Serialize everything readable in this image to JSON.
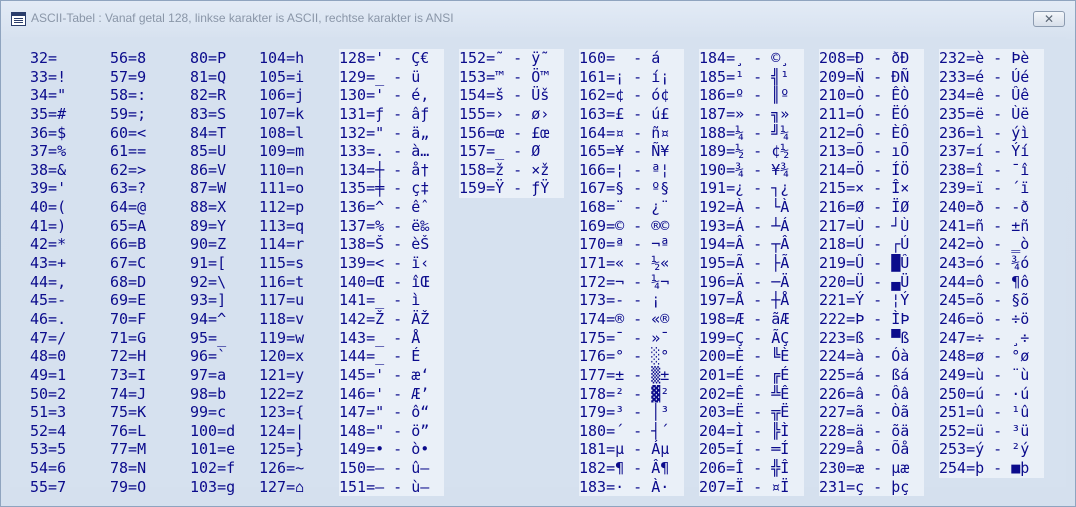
{
  "window": {
    "title": "ASCII-Tabel : Vanaf getal 128, linkse karakter is ASCII, rechtse karakter is ANSI",
    "close_label": "✕"
  },
  "columns": [
    [
      "32= ",
      "33=!",
      "34=\"",
      "35=#",
      "36=$",
      "37=%",
      "38=&",
      "39='",
      "40=(",
      "41=)",
      "42=*",
      "43=+",
      "44=,",
      "45=-",
      "46=.",
      "47=/",
      "48=0",
      "49=1",
      "50=2",
      "51=3",
      "52=4",
      "53=5",
      "54=6",
      "55=7"
    ],
    [
      "56=8",
      "57=9",
      "58=:",
      "59=;",
      "60=<",
      "61==",
      "62=>",
      "63=?",
      "64=@",
      "65=A",
      "66=B",
      "67=C",
      "68=D",
      "69=E",
      "70=F",
      "71=G",
      "72=H",
      "73=I",
      "74=J",
      "75=K",
      "76=L",
      "77=M",
      "78=N",
      "79=O"
    ],
    [
      "80=P",
      "81=Q",
      "82=R",
      "83=S",
      "84=T",
      "85=U",
      "86=V",
      "87=W",
      "88=X",
      "89=Y",
      "90=Z",
      "91=[",
      "92=\\",
      "93=]",
      "94=^",
      "95=_",
      "96=`",
      "97=a",
      "98=b",
      "99=c",
      "100=d",
      "101=e",
      "102=f",
      "103=g"
    ],
    [
      "104=h",
      "105=i",
      "106=j",
      "107=k",
      "108=l",
      "109=m",
      "110=n",
      "111=o",
      "112=p",
      "113=q",
      "114=r",
      "115=s",
      "116=t",
      "117=u",
      "118=v",
      "119=w",
      "120=x",
      "121=y",
      "122=z",
      "123={",
      "124=|",
      "125=}",
      "126=~",
      "127=⌂"
    ],
    [
      "128=' - Ç€",
      "129=_ - ü",
      "130=' - é‚",
      "131=ƒ - âƒ",
      "132=\" - ä„",
      "133=. - à…",
      "134=┼ - å†",
      "135=╪ - ç‡",
      "136=^ - êˆ",
      "137=% - ë‰",
      "138=Š - èŠ",
      "139=< - ï‹",
      "140=Œ - îŒ",
      "141=_ - ì",
      "142=Ž - ÄŽ",
      "143=_ - Å",
      "144=_ - É",
      "145=' - æ‘",
      "146=' - Æ’",
      "147=\" - ô“",
      "148=\" - ö”",
      "149=• - ò•",
      "150=– - û–",
      "151=— - ù—"
    ],
    [
      "152=˜ - ÿ˜",
      "153=™ - Ö™",
      "154=š - Üš",
      "155=› - ø›",
      "156=œ - £œ",
      "157=_ - Ø",
      "158=ž - ×ž",
      "159=Ÿ - ƒŸ"
    ],
    [
      "160=  - á",
      "161=¡ - í¡",
      "162=¢ - ó¢",
      "163=£ - ú£",
      "164=¤ - ñ¤",
      "165=¥ - Ñ¥",
      "166=¦ - ª¦",
      "167=§ - º§",
      "168=¨ - ¿¨",
      "169=© - ®©",
      "170=ª - ¬ª",
      "171=« - ½«",
      "172=¬ - ¼¬",
      "173=- - ¡",
      "174=® - «®",
      "175=¯ - »¯",
      "176=° - ░°",
      "177=± - ▒±",
      "178=² - ▓²",
      "179=³ - │³",
      "180=´ - ┤´",
      "181=µ - Áµ",
      "182=¶ - Â¶",
      "183=· - À·"
    ],
    [
      "184=¸ - ©¸",
      "185=¹ - ╣¹",
      "186=º - ║º",
      "187=» - ╗»",
      "188=¼ - ╝¼",
      "189=½ - ¢½",
      "190=¾ - ¥¾",
      "191=¿ - ┐¿",
      "192=À - └À",
      "193=Á - ┴Á",
      "194=Â - ┬Â",
      "195=Ã - ├Ã",
      "196=Ä - ─Ä",
      "197=Å - ┼Å",
      "198=Æ - ãÆ",
      "199=Ç - ÃÇ",
      "200=È - ╚È",
      "201=É - ╔É",
      "202=Ê - ╩Ê",
      "203=Ë - ╦Ë",
      "204=Ì - ╠Ì",
      "205=Í - ═Í",
      "206=Î - ╬Î",
      "207=Ï - ¤Ï"
    ],
    [
      "208=Ð - ðÐ",
      "209=Ñ - ÐÑ",
      "210=Ò - ÊÒ",
      "211=Ó - ËÓ",
      "212=Ô - ÈÔ",
      "213=Õ - ıÕ",
      "214=Ö - ÍÖ",
      "215=× - Î×",
      "216=Ø - ÏØ",
      "217=Ù - ┘Ù",
      "218=Ú - ┌Ú",
      "219=Û - █Û",
      "220=Ü - ▄Ü",
      "221=Ý - ¦Ý",
      "222=Þ - ÌÞ",
      "223=ß - ▀ß",
      "224=à - Óà",
      "225=á - ßá",
      "226=â - Ôâ",
      "227=ã - Òã",
      "228=ä - õä",
      "229=å - Õå",
      "230=æ - µæ",
      "231=ç - þç"
    ],
    [
      "232=è - Þè",
      "233=é - Úé",
      "234=ê - Ûê",
      "235=ë - Ùë",
      "236=ì - ýì",
      "237=í - Ýí",
      "238=î - ¯î",
      "239=ï - ´ï",
      "240=ð - -ð",
      "241=ñ - ±ñ",
      "242=ò - ‗ò",
      "243=ó - ¾ó",
      "244=ô - ¶ô",
      "245=õ - §õ",
      "246=ö - ÷ö",
      "247=÷ - ¸÷",
      "248=ø - °ø",
      "249=ù - ¨ù",
      "250=ú - ·ú",
      "251=û - ¹û",
      "252=ü - ³ü",
      "253=ý - ²ý",
      "254=þ - ■þ"
    ]
  ]
}
